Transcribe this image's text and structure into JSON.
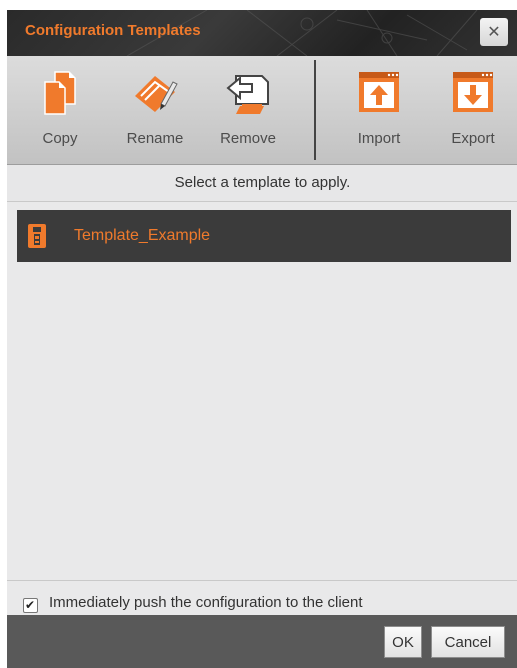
{
  "dialog": {
    "title": "Configuration Templates",
    "close_glyph": "✕"
  },
  "toolbar": {
    "items": [
      {
        "label": "Copy",
        "icon": "copy-icon"
      },
      {
        "label": "Rename",
        "icon": "rename-icon"
      },
      {
        "label": "Remove",
        "icon": "remove-icon"
      },
      {
        "label": "Import",
        "icon": "import-icon"
      },
      {
        "label": "Export",
        "icon": "export-icon"
      }
    ]
  },
  "instruction": "Select a template to apply.",
  "templates": [
    {
      "name": "Template_Example",
      "icon": "template-file-icon",
      "selected": true
    }
  ],
  "option": {
    "label": "Immediately push the configuration to the client",
    "checked": true,
    "check_glyph": "✔"
  },
  "footer": {
    "ok_label": "OK",
    "cancel_label": "Cancel"
  },
  "colors": {
    "accent": "#f07a2c",
    "titlebar": "#2e2e2e",
    "footer": "#595959"
  }
}
